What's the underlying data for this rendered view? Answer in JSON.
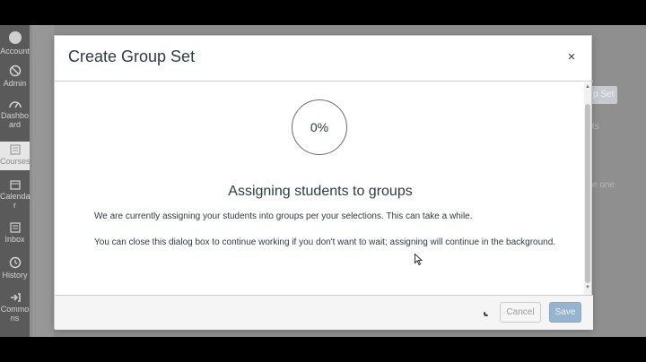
{
  "nav": {
    "items": [
      {
        "label": "Account",
        "icon": "account-icon"
      },
      {
        "label": "Admin",
        "icon": "admin-icon"
      },
      {
        "label": "Dashbo ard",
        "icon": "dashboard-icon"
      },
      {
        "label": "Courses",
        "icon": "courses-icon"
      },
      {
        "label": "Calenda r",
        "icon": "calendar-icon"
      },
      {
        "label": "Inbox",
        "icon": "inbox-icon"
      },
      {
        "label": "History",
        "icon": "history-icon"
      },
      {
        "label": "Commo ns",
        "icon": "commons-icon"
      }
    ]
  },
  "background": {
    "button_label": "p Set",
    "text_ts": "ts",
    "text_one": "e one"
  },
  "dialog": {
    "title": "Create Group Set",
    "close_label": "×",
    "progress_text": "0%",
    "progress_value": 0,
    "heading": "Assigning students to groups",
    "message1": "We are currently assigning your students into groups per your selections. This can take a while.",
    "message2": "You can close this dialog box to continue working if you don't want to wait; assigning will continue in the background.",
    "cancel_label": "Cancel",
    "save_label": "Save"
  }
}
